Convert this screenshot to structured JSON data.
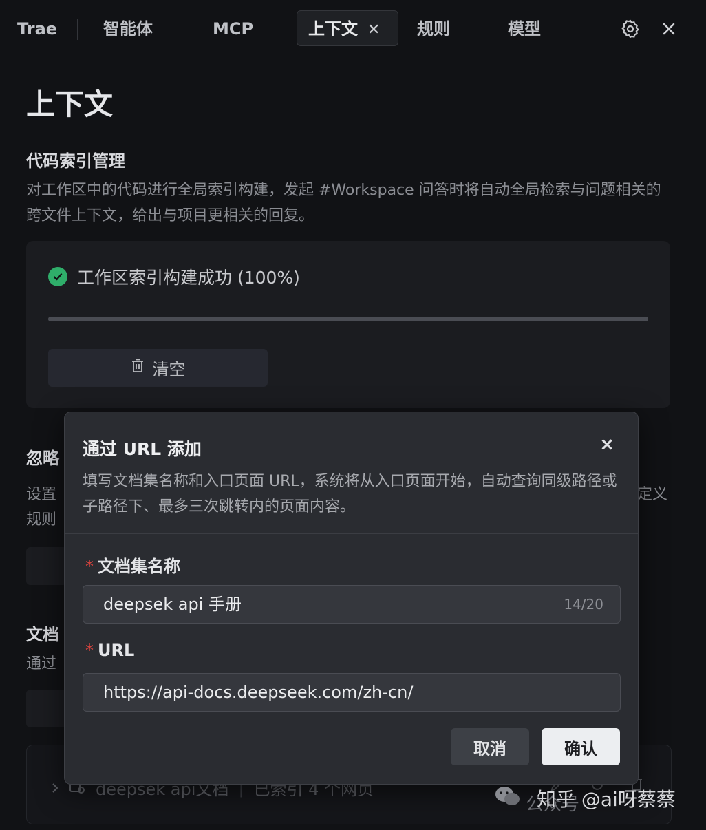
{
  "tabs": {
    "trae": "Trae",
    "agents": "智能体",
    "mcp": "MCP",
    "context": "上下文",
    "rules": "规则",
    "models": "模型",
    "close_glyph": "✕"
  },
  "icons": {
    "settings": "gear-icon",
    "close": "close-icon",
    "check": "check-circle-icon",
    "trash": "trash-icon"
  },
  "page": {
    "title": "上下文",
    "index": {
      "title": "代码索引管理",
      "desc": "对工作区中的代码进行全局索引构建，发起 #Workspace 问答时将自动全局检索与问题相关的跨文件上下文，给出与项目更相关的回复。",
      "status": "工作区索引构建成功 (100%)",
      "progress_percent": 100,
      "clear_label": "清空"
    },
    "ignore": {
      "title_partial": "忽略",
      "desc_line1_partial": "设置",
      "desc_line1_tail": "定义",
      "desc_line2_partial": "规则"
    },
    "docs": {
      "title_partial": "文档",
      "desc_partial": "通过",
      "row_name": "deepsek api文档",
      "row_status": "已索引 4 个网页"
    }
  },
  "modal": {
    "title": "通过 URL 添加",
    "close_glyph": "×",
    "desc": "填写文档集名称和入口页面 URL，系统将从入口页面开始，自动查询同级路径或子路径下、最多三次跳转内的页面内容。",
    "name_label": "文档集名称",
    "name_value": "deepsek api 手册",
    "name_count": "14/20",
    "url_label": "URL",
    "url_value": "https://api-docs.deepseek.com/zh-cn/",
    "required_mark": "*",
    "cancel_label": "取消",
    "confirm_label": "确认"
  },
  "watermark": {
    "dim_text": "公众号",
    "text": "知乎 @ai呀蔡蔡"
  },
  "colors": {
    "background": "#111215",
    "modal_bg": "#2a2c31",
    "success": "#2fae6a",
    "required": "#e0453f",
    "confirm_bg": "#eceef1"
  }
}
